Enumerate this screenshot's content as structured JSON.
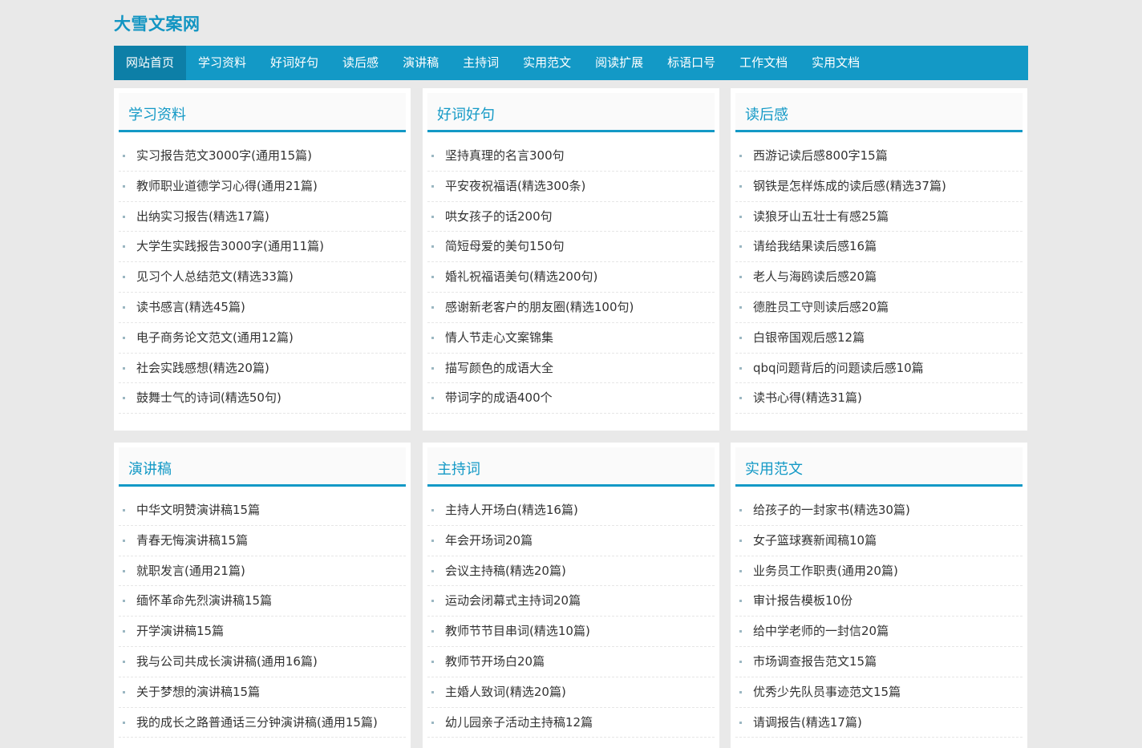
{
  "site": {
    "logo": "大雪文案网"
  },
  "nav": [
    "网站首页",
    "学习资料",
    "好词好句",
    "读后感",
    "演讲稿",
    "主持词",
    "实用范文",
    "阅读扩展",
    "标语口号",
    "工作文档",
    "实用文档"
  ],
  "panels": [
    {
      "title": "学习资料",
      "items": [
        "实习报告范文3000字(通用15篇)",
        "教师职业道德学习心得(通用21篇)",
        "出纳实习报告(精选17篇)",
        "大学生实践报告3000字(通用11篇)",
        "见习个人总结范文(精选33篇)",
        "读书感言(精选45篇)",
        "电子商务论文范文(通用12篇)",
        "社会实践感想(精选20篇)",
        "鼓舞士气的诗词(精选50句)"
      ]
    },
    {
      "title": "好词好句",
      "items": [
        "坚持真理的名言300句",
        "平安夜祝福语(精选300条)",
        "哄女孩子的话200句",
        "简短母爱的美句150句",
        "婚礼祝福语美句(精选200句)",
        "感谢新老客户的朋友圈(精选100句)",
        "情人节走心文案锦集",
        "描写颜色的成语大全",
        "带词字的成语400个"
      ]
    },
    {
      "title": "读后感",
      "items": [
        "西游记读后感800字15篇",
        "钢铁是怎样炼成的读后感(精选37篇)",
        "读狼牙山五壮士有感25篇",
        "请给我结果读后感16篇",
        "老人与海鸥读后感20篇",
        "德胜员工守则读后感20篇",
        "白银帝国观后感12篇",
        "qbq问题背后的问题读后感10篇",
        "读书心得(精选31篇)"
      ]
    },
    {
      "title": "演讲稿",
      "items": [
        "中华文明赞演讲稿15篇",
        "青春无悔演讲稿15篇",
        "就职发言(通用21篇)",
        "缅怀革命先烈演讲稿15篇",
        "开学演讲稿15篇",
        "我与公司共成长演讲稿(通用16篇)",
        "关于梦想的演讲稿15篇",
        "我的成长之路普通话三分钟演讲稿(通用15篇)"
      ]
    },
    {
      "title": "主持词",
      "items": [
        "主持人开场白(精选16篇)",
        "年会开场词20篇",
        "会议主持稿(精选20篇)",
        "运动会闭幕式主持词20篇",
        "教师节节目串词(精选10篇)",
        "教师节开场白20篇",
        "主婚人致词(精选20篇)",
        "幼儿园亲子活动主持稿12篇"
      ]
    },
    {
      "title": "实用范文",
      "items": [
        "给孩子的一封家书(精选30篇)",
        "女子篮球赛新闻稿10篇",
        "业务员工作职责(通用20篇)",
        "审计报告模板10份",
        "给中学老师的一封信20篇",
        "市场调查报告范文15篇",
        "优秀少先队员事迹范文15篇",
        "请调报告(精选17篇)"
      ]
    }
  ]
}
